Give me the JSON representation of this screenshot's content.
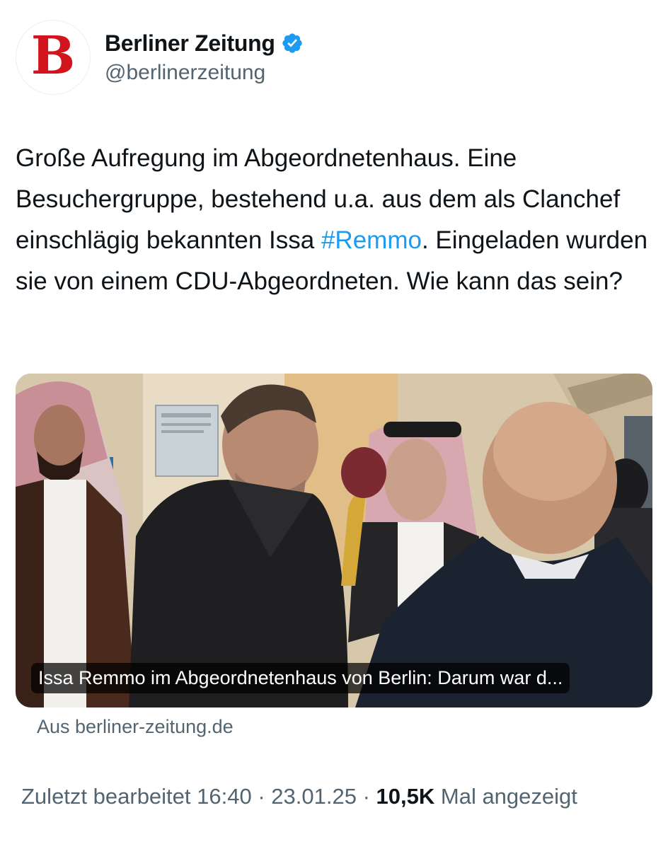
{
  "account": {
    "display_name": "Berliner Zeitung",
    "handle": "@berlinerzeitung",
    "verified": true,
    "avatar_letter": "B",
    "brand_color": "#d2151c"
  },
  "tweet": {
    "text_before": "Große Aufregung im Abgeordnetenhaus. Eine Besuchergruppe, bestehend u.a. aus dem als Clanchef einschlägig bekannten Issa ",
    "hashtag": "#Remmo",
    "text_after": ". Eingeladen wurden sie von einem CDU-Abgeordneten. Wie kann das sein?"
  },
  "link_card": {
    "caption": "Issa Remmo im Abgeordnetenhaus von Berlin: Darum war d...",
    "source": "Aus berliner-zeitung.de"
  },
  "footer": {
    "edited": "Zuletzt bearbeitet 16:40 · 23.01.25",
    "separator": "·",
    "views_count": "10,5K",
    "views_label": "Mal angezeigt"
  },
  "colors": {
    "verified": "#1d9bf0",
    "hashtag": "#1d9bf0",
    "secondary_text": "#536471"
  }
}
